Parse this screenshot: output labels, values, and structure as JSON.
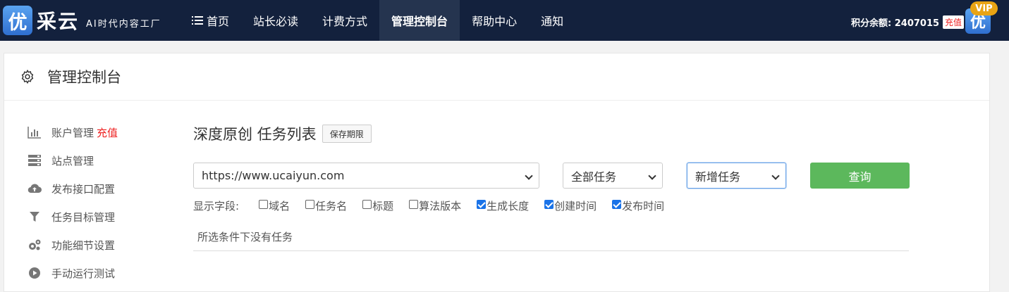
{
  "brand": {
    "badge_char": "优",
    "name": "采云",
    "slogan": "AI时代内容工厂"
  },
  "nav": {
    "items": [
      {
        "label": "首页",
        "icon": "menu-icon"
      },
      {
        "label": "站长必读"
      },
      {
        "label": "计费方式"
      },
      {
        "label": "管理控制台",
        "active": true
      },
      {
        "label": "帮助中心"
      },
      {
        "label": "通知"
      }
    ]
  },
  "account": {
    "points_label": "积分余额: 2407015",
    "recharge_label": "充值",
    "avatar_char": "优",
    "vip_label": "VIP"
  },
  "panel": {
    "title": "管理控制台",
    "icon": "gear-icon"
  },
  "sidebar": {
    "items": [
      {
        "label": "账户管理",
        "extra": "充值",
        "icon": "bar-chart-icon"
      },
      {
        "label": "站点管理",
        "icon": "server-icon"
      },
      {
        "label": "发布接口配置",
        "icon": "cloud-upload-icon"
      },
      {
        "label": "任务目标管理",
        "icon": "filter-icon"
      },
      {
        "label": "功能细节设置",
        "icon": "gears-icon"
      },
      {
        "label": "手动运行测试",
        "icon": "play-circle-icon"
      }
    ]
  },
  "main": {
    "heading": "深度原创 任务列表",
    "save_period_label": "保存期限",
    "site_select_value": "https://www.ucaiyun.com",
    "task_filter_value": "全部任务",
    "action_select_value": "新增任务",
    "query_label": "查询",
    "fields_label": "显示字段:",
    "fields": [
      {
        "label": "域名",
        "checked": false
      },
      {
        "label": "任务名",
        "checked": false
      },
      {
        "label": "标题",
        "checked": false
      },
      {
        "label": "算法版本",
        "checked": false
      },
      {
        "label": "生成长度",
        "checked": true
      },
      {
        "label": "创建时间",
        "checked": true
      },
      {
        "label": "发布时间",
        "checked": true
      }
    ],
    "empty_text": "所选条件下没有任务"
  },
  "colors": {
    "topbar": "#13213d",
    "nav_active": "#25344f",
    "query_button": "#5cb85c",
    "recharge_red": "#e22222",
    "vip_gold": "#e9a414"
  }
}
